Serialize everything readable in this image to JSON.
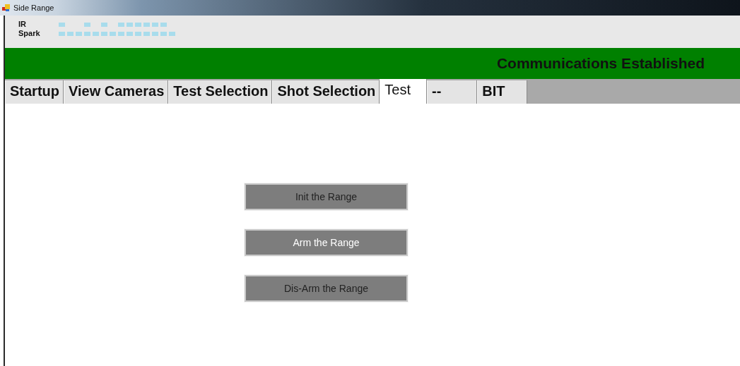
{
  "window": {
    "title": "Side Range"
  },
  "indicators": [
    {
      "label": "IR"
    },
    {
      "label": "Spark"
    }
  ],
  "status_banner": {
    "text": "Communications Established"
  },
  "tabs": [
    {
      "label": "Startup",
      "selected": false
    },
    {
      "label": "View Cameras",
      "selected": false
    },
    {
      "label": "Test Selection",
      "selected": false
    },
    {
      "label": "Shot Selection",
      "selected": false
    },
    {
      "label": "Test",
      "selected": true
    },
    {
      "label": "--",
      "selected": false
    },
    {
      "label": "BIT",
      "selected": false
    }
  ],
  "buttons": [
    {
      "label": "Init the Range",
      "highlighted": false
    },
    {
      "label": "Arm the Range",
      "highlighted": true
    },
    {
      "label": "Dis-Arm the Range",
      "highlighted": false
    }
  ]
}
